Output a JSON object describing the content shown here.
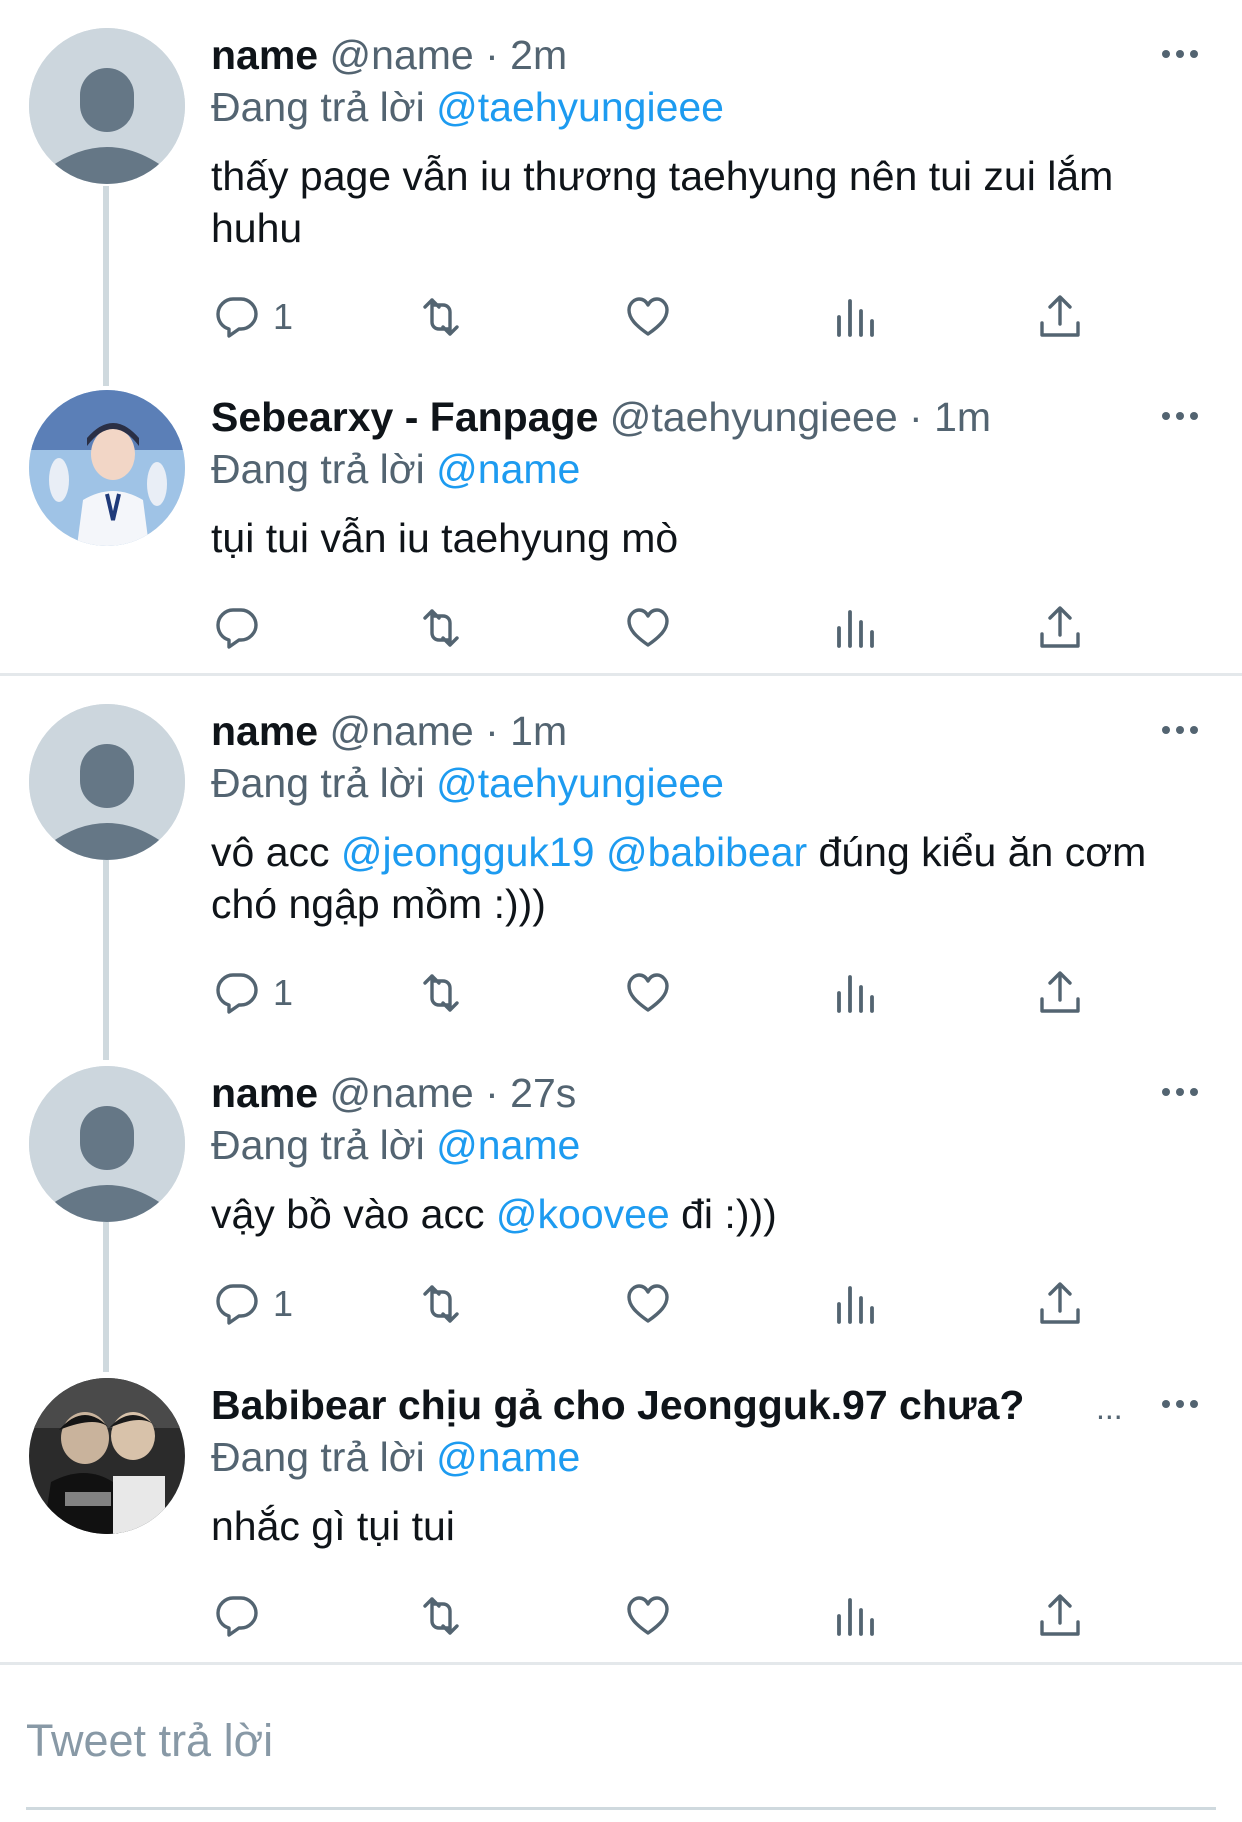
{
  "colors": {
    "link": "#1d9bf0",
    "secondary": "#536471",
    "text": "#0f1419",
    "divider": "#e4e8eb"
  },
  "tweets": [
    {
      "name": "name",
      "handle": "@name",
      "sep": " · ",
      "time": "2m",
      "reply_prefix": "Đang trả lời ",
      "reply_to": "@taehyungieee",
      "body_parts": [
        "thấy page vẫn iu thương taehyung nên tui zui lắm huhu"
      ],
      "reply_count": "1",
      "avatar": "default-avatar-icon"
    },
    {
      "name": "Sebearxy - Fanpage",
      "handle": "@taehyungieee",
      "sep": " · ",
      "time": "1m",
      "reply_prefix": "Đang trả lời ",
      "reply_to": "@name",
      "body_parts": [
        "tụi tui vẫn iu taehyung mò"
      ],
      "reply_count": "",
      "avatar": "profile-photo"
    },
    {
      "name": "name",
      "handle": "@name",
      "sep": " · ",
      "time": "1m",
      "reply_prefix": "Đang trả lời ",
      "reply_to": "@taehyungieee",
      "body_parts": [
        "vô acc ",
        "@jeongguk19",
        " ",
        "@babibear",
        " đúng kiểu ăn cơm chó ngập mồm :)))"
      ],
      "reply_count": "1",
      "avatar": "default-avatar-icon"
    },
    {
      "name": "name",
      "handle": "@name",
      "sep": " · ",
      "time": "27s",
      "reply_prefix": "Đang trả lời ",
      "reply_to": "@name",
      "body_parts": [
        "vậy bồ vào acc ",
        "@koovee",
        " đi :)))"
      ],
      "reply_count": "1",
      "avatar": "default-avatar-icon"
    },
    {
      "name": "Babibear chịu gả cho Jeongguk.97 chưa?",
      "name_ellipsis": "...",
      "reply_prefix": "Đang trả lời ",
      "reply_to": "@name",
      "body_parts": [
        "nhắc gì tụi tui"
      ],
      "reply_count": "",
      "avatar": "profile-photo"
    }
  ],
  "compose": {
    "placeholder": "Tweet trả lời"
  }
}
